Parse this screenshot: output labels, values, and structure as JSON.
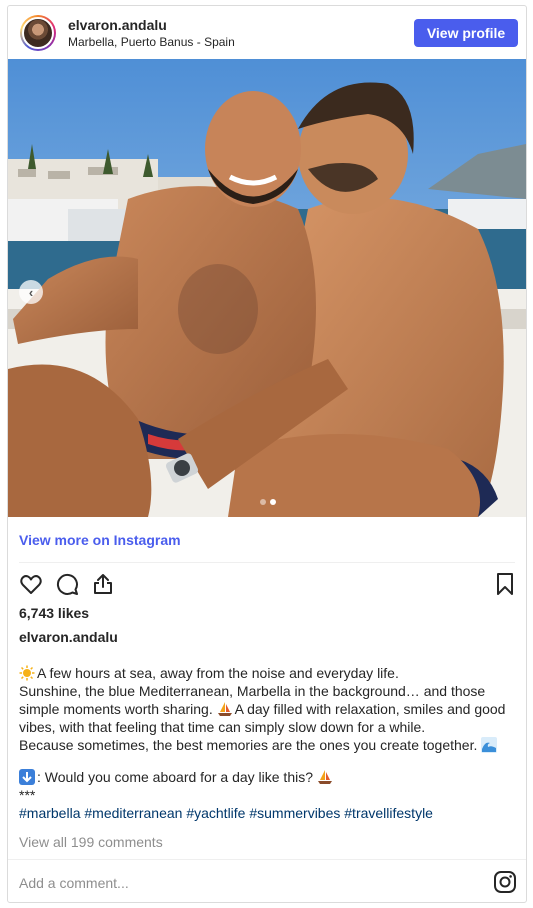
{
  "header": {
    "username": "elvaron.andalu",
    "location": "Marbella, Puerto Banus - Spain",
    "view_profile_label": "View profile"
  },
  "media": {
    "carousel_prev_icon": "chevron-left-icon",
    "slide_count": 2,
    "active_slide": 2
  },
  "view_more_label": "View more on Instagram",
  "actions": {
    "like_icon": "heart-icon",
    "comment_icon": "comment-icon",
    "share_icon": "share-icon",
    "save_icon": "bookmark-icon"
  },
  "likes_label": "6,743 likes",
  "caption": {
    "username": "elvaron.andalu",
    "line1": "A few hours at sea, away from the noise and everyday life.",
    "line2": "Sunshine, the blue Mediterranean, Marbella in the background… and those simple moments worth sharing.",
    "line2b": "A day filled with relaxation, smiles and good vibes, with that feeling that time can simply slow down for a while.",
    "line3": "Because sometimes, the best memories are the ones you create together.",
    "question": ": Would you come aboard for a day like this?",
    "stars": "***",
    "hashtags": "#marbella #mediterranean #yachtlife #summervibes #travellifestyle"
  },
  "view_comments_label": "View all 199 comments",
  "add_comment_placeholder": "Add a comment...",
  "colors": {
    "accent": "#4a5ded",
    "hashtag": "#00376b",
    "muted": "#8e8e8e"
  }
}
